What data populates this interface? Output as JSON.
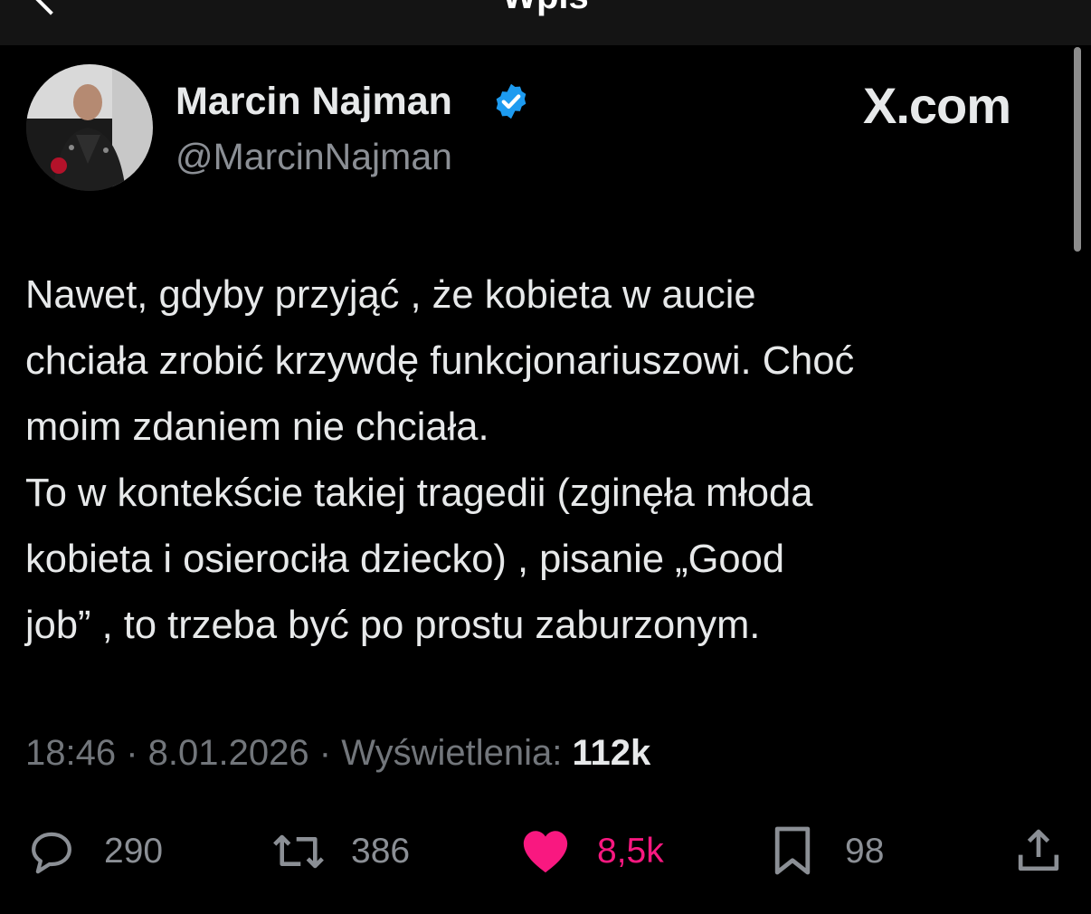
{
  "header": {
    "title": "Wpis"
  },
  "author": {
    "name": "Marcin Najman",
    "handle": "@MarcinNajman",
    "verified": true
  },
  "brand": "X.com",
  "tweet": {
    "lines": [
      "Nawet, gdyby przyjąć , że kobieta w aucie",
      "chciała zrobić krzywdę funkcjonariuszowi. Choć",
      "moim zdaniem nie chciała.",
      "To w kontekście takiej tragedii (zginęła młoda",
      "kobieta i osierociła dziecko) , pisanie „Good",
      "job” , to trzeba być po prostu zaburzonym."
    ]
  },
  "meta": {
    "time": "18:46",
    "date": "8.01.2026",
    "views_label": "Wyświetlenia:",
    "views_count": "112k"
  },
  "actions": {
    "replies": "290",
    "reposts": "386",
    "likes": "8,5k",
    "bookmarks": "98"
  },
  "colors": {
    "background": "#000000",
    "text": "#e7e9ea",
    "secondary": "#8b8f95",
    "verified": "#1d9bf0",
    "like": "#f91880"
  },
  "icons": {
    "back": "chevron-left-icon",
    "verified": "verified-badge-icon",
    "reply": "speech-bubble-icon",
    "repost": "repost-arrows-icon",
    "like": "heart-filled-icon",
    "bookmark": "bookmark-icon",
    "share": "share-icon"
  }
}
